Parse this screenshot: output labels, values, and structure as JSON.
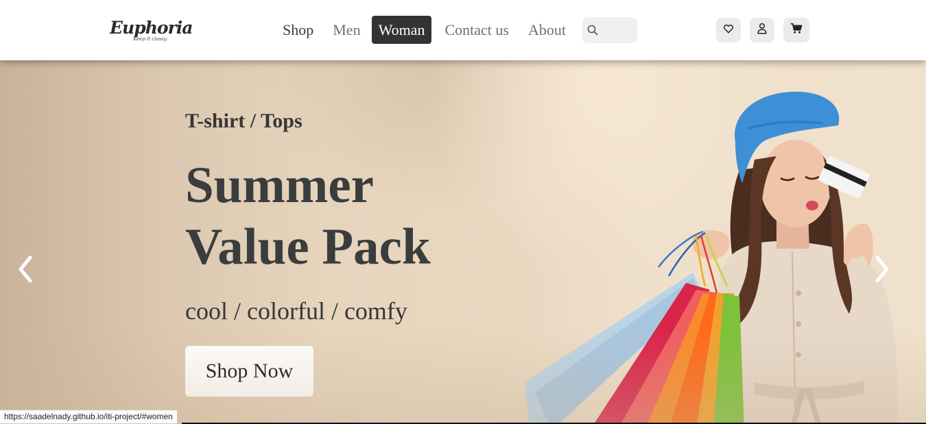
{
  "logo": {
    "name": "Euphoria",
    "tagline": "Keep it classy."
  },
  "nav": {
    "links": [
      {
        "label": "Shop"
      },
      {
        "label": "Men"
      },
      {
        "label": "Woman"
      },
      {
        "label": "Contact us"
      },
      {
        "label": "About"
      }
    ],
    "active": "Woman"
  },
  "search": {
    "placeholder": "",
    "value": ""
  },
  "icons": {
    "wishlist": "heart-icon",
    "account": "user-icon",
    "cart": "cart-icon",
    "search": "search-icon"
  },
  "hero": {
    "subtitle": "T-shirt / Tops",
    "title_line1": "Summer",
    "title_line2": "Value Pack",
    "tagline": "cool / colorful / comfy",
    "cta_label": "Shop Now"
  },
  "status_bar": {
    "url": "https://saadelnady.github.io/iti-project/#women"
  },
  "colors": {
    "active_nav_bg": "#333333",
    "hero_bg": "#e6d4bd",
    "title_text": "#3a3d3e",
    "beret": "#3d8fd6"
  }
}
